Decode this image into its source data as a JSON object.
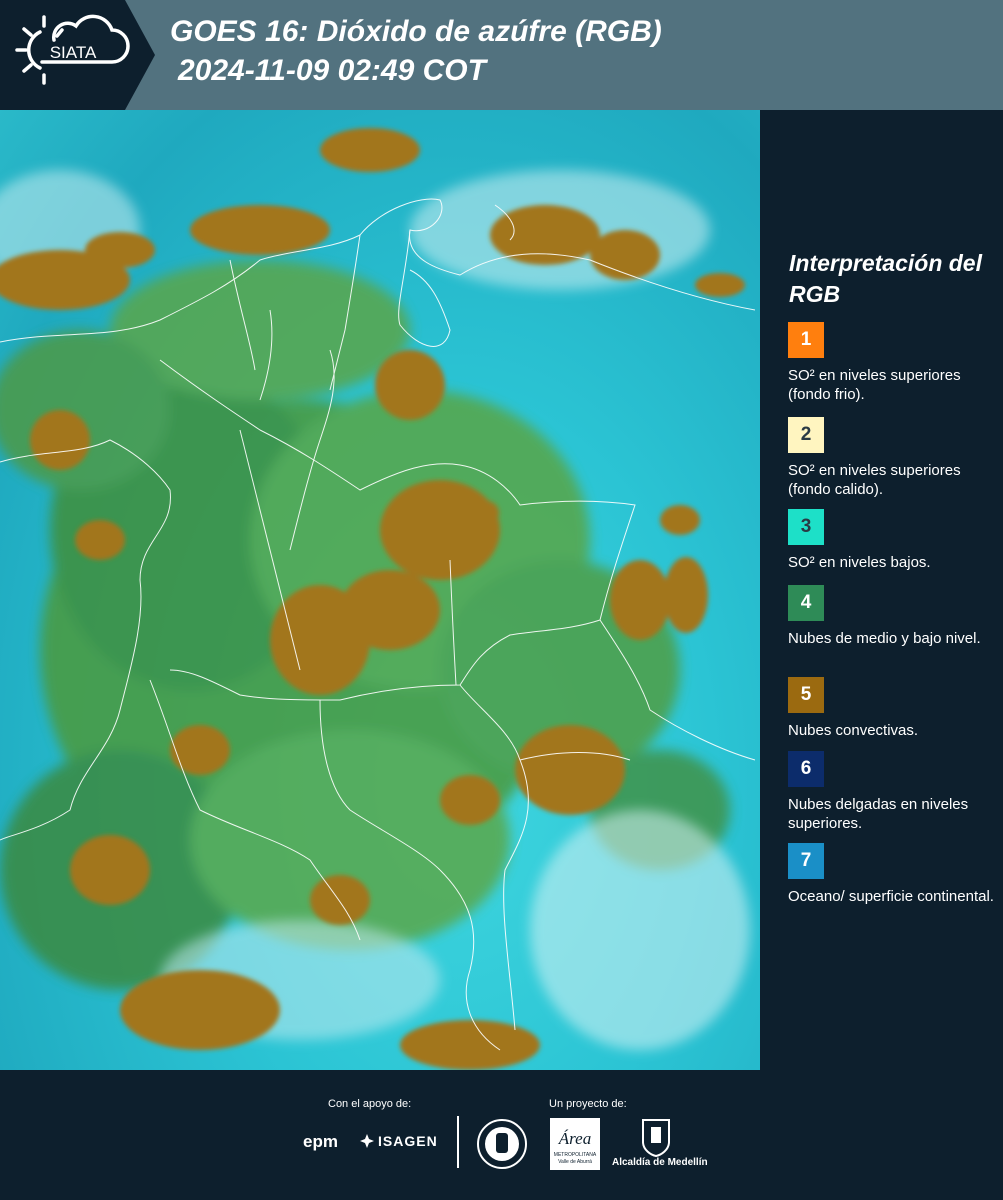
{
  "header": {
    "logo_text": "SIATA",
    "title_line1": "GOES 16: Dióxido de azúfre (RGB)",
    "title_line2": "2024-11-09 02:49 COT"
  },
  "legend": {
    "title": "Interpretación del RGB",
    "items": [
      {
        "number": "1",
        "color": "#ff7f0e",
        "label": "SO² en niveles superiores (fondo frio)."
      },
      {
        "number": "2",
        "color": "#fff5c0",
        "label": "SO² en niveles superiores (fondo calido)."
      },
      {
        "number": "3",
        "color": "#1de0c8",
        "label": "SO² en niveles bajos."
      },
      {
        "number": "4",
        "color": "#2e8b57",
        "label": "Nubes de medio y bajo nivel."
      },
      {
        "number": "5",
        "color": "#9b6a10",
        "label": "Nubes convectivas."
      },
      {
        "number": "6",
        "color": "#0c2c6b",
        "label": "Nubes delgadas en niveles superiores."
      },
      {
        "number": "7",
        "color": "#1a8fc7",
        "label": "Oceano/ superficie continental."
      }
    ]
  },
  "footer": {
    "support_caption": "Con el apoyo de:",
    "project_caption": "Un proyecto de:",
    "epm_label": "epm",
    "isagen_label": "ISAGEN",
    "area_label": "Área",
    "area_sub1": "METROPOLITANA",
    "area_sub2": "Valle de Aburrá",
    "alcaldia_label": "Alcaldía de Medellín"
  }
}
